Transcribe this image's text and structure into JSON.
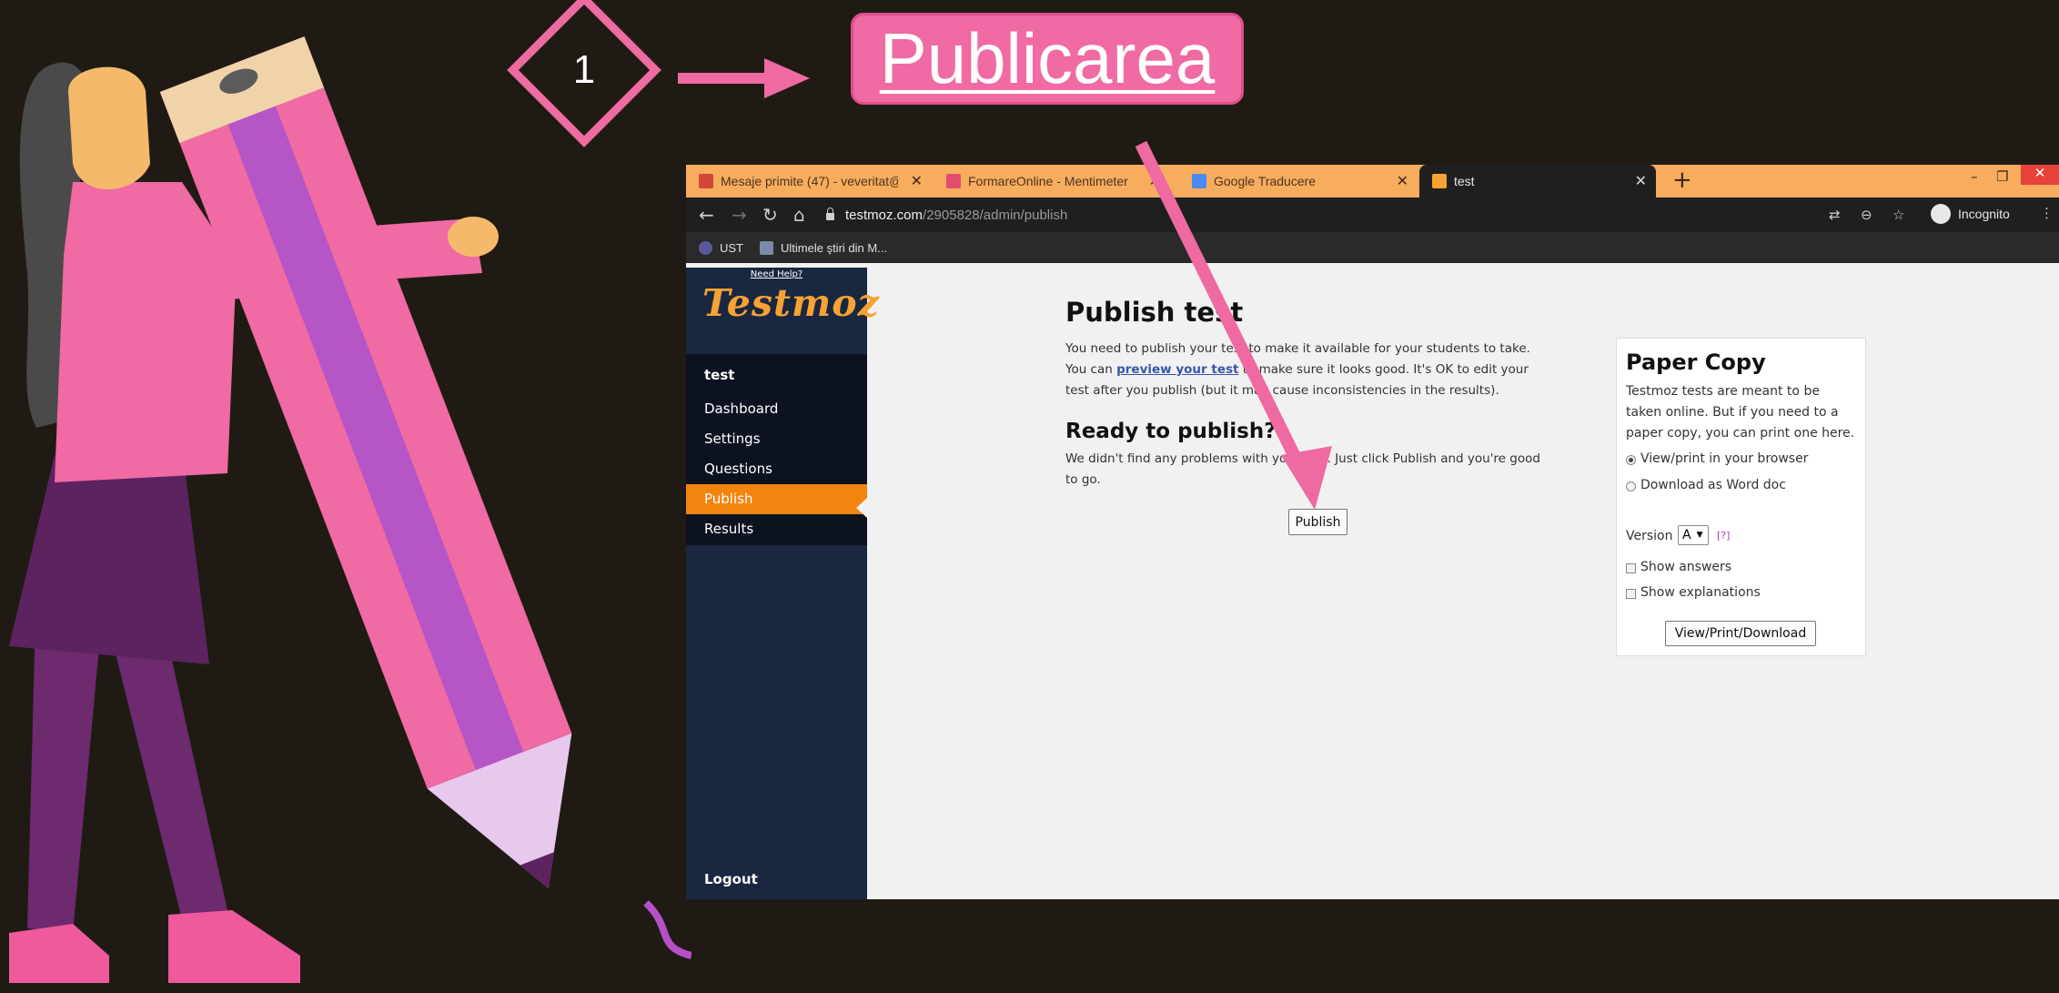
{
  "slide": {
    "step_number": "1",
    "title": "Publicarea"
  },
  "browser": {
    "tabs": [
      {
        "label": "Mesaje primite (47) - veveritat@",
        "icon": "gmail-icon",
        "color": "#d44638"
      },
      {
        "label": "FormareOnline - Mentimeter",
        "icon": "mentimeter-icon",
        "color": "#e24d6d"
      },
      {
        "label": "Google Traducere",
        "icon": "google-translate-icon",
        "color": "#4a8af4"
      },
      {
        "label": "test",
        "icon": "testmoz-icon",
        "color": "#f7a233"
      }
    ],
    "url_host": "testmoz.com",
    "url_path": "/2905828/admin/publish",
    "profile": "Incognito",
    "bookmarks": [
      "UST",
      "Ultimele ştiri din M..."
    ]
  },
  "sidebar": {
    "need_help": "Need Help?",
    "logo": "Testmoz",
    "test_name": "test",
    "items": [
      "Dashboard",
      "Settings",
      "Questions",
      "Publish",
      "Results"
    ],
    "active_item": "Publish",
    "logout": "Logout"
  },
  "main": {
    "heading": "Publish test",
    "intro_line1": "You need to publish your test to make it available for your students to take.",
    "intro_line2_a": "You can ",
    "intro_link": "preview your test",
    "intro_line2_b": " to make sure it looks good. It's OK to edit your",
    "intro_line3": "test after you publish (but it may cause inconsistencies in the results).",
    "ready_heading": "Ready to publish?",
    "ready_line1": "We didn't find any problems with your test. Just click Publish and you're good",
    "ready_line2": "to go.",
    "publish_button": "Publish"
  },
  "paper_copy": {
    "heading": "Paper Copy",
    "desc_line1": "Testmoz tests are meant to be",
    "desc_line2": "taken online. But if you need to a",
    "desc_line3": "paper copy, you can print one here.",
    "option_browser": "View/print in your browser",
    "option_word": "Download as Word doc",
    "version_label": "Version",
    "version_value": "A",
    "version_help": "[?]",
    "show_answers": "Show answers",
    "show_explanations": "Show explanations",
    "button": "View/Print/Download"
  },
  "colors": {
    "accent_pink": "#f06aa3",
    "testmoz_orange": "#f2840f",
    "sidebar_navy": "#1a2740"
  }
}
